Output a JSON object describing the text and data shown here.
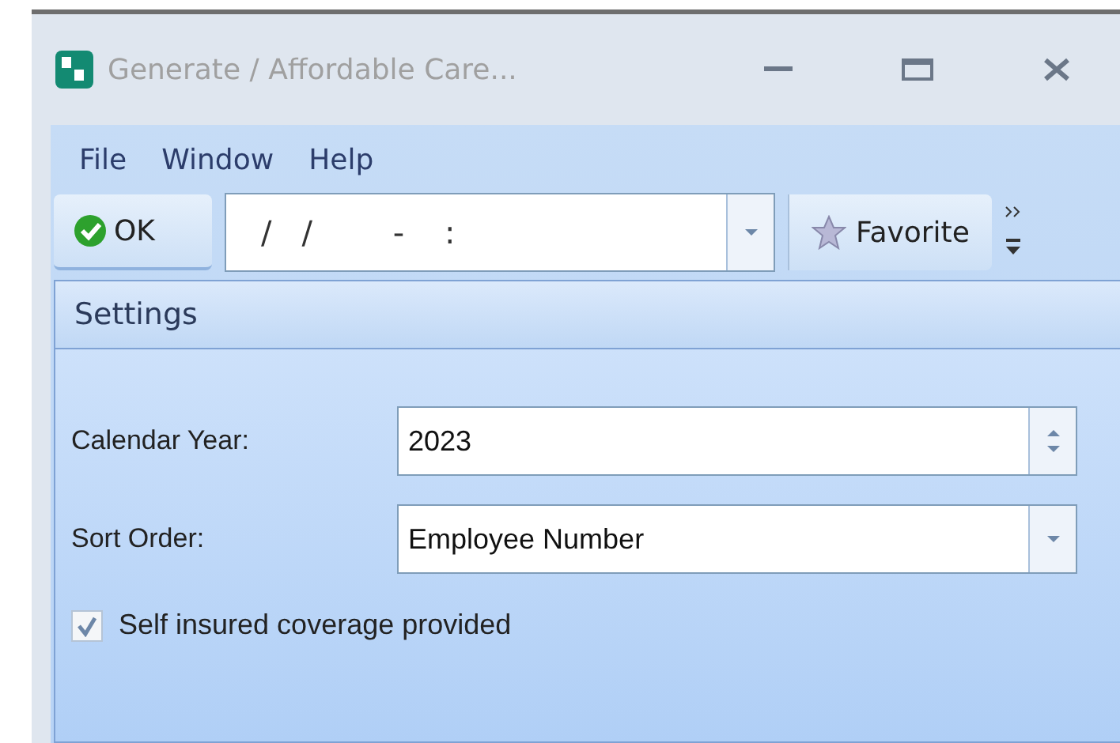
{
  "window": {
    "title": "Generate / Affordable Care..."
  },
  "menu": [
    "File",
    "Window",
    "Help"
  ],
  "toolbar": {
    "ok_button": "OK",
    "date_field": "/   /        -    :",
    "favorite_button": "Favorite"
  },
  "settings": {
    "header": "Settings",
    "fields": [
      {
        "kind": "spin",
        "label": "Calendar Year:",
        "value": "2023"
      },
      {
        "kind": "dropdown",
        "label": "Sort Order:",
        "value": "Employee Number"
      }
    ],
    "checkbox": {
      "label": "Self insured coverage provided",
      "checked": true
    }
  }
}
